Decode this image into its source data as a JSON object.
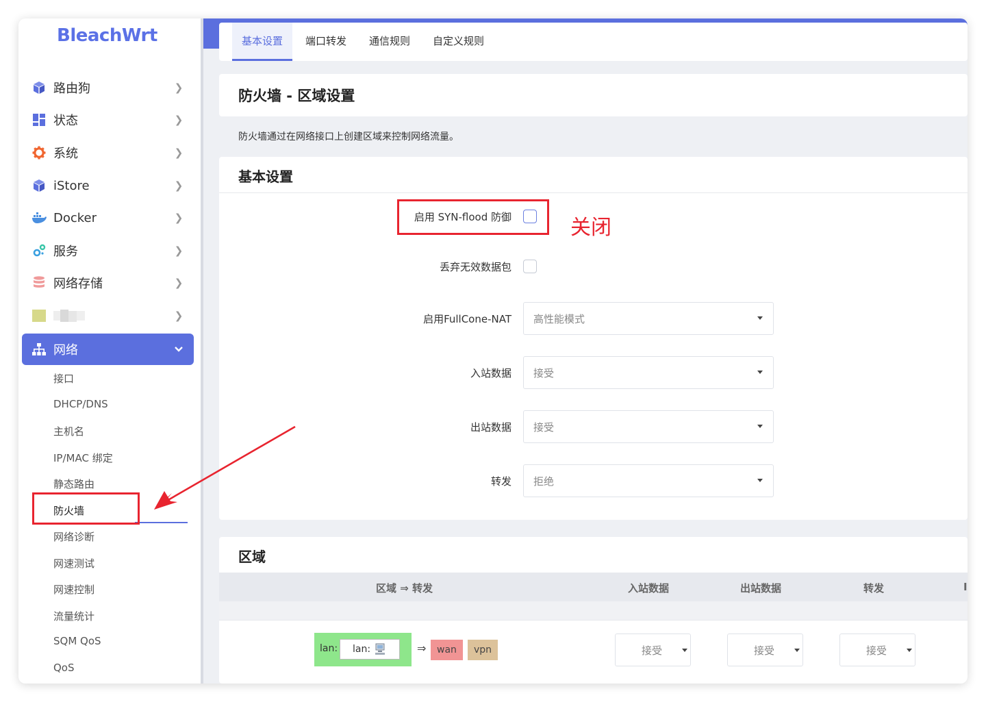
{
  "logo": "BleachWrt",
  "sidebar": {
    "items": [
      {
        "label": "路由狗",
        "icon": "cube-icon",
        "color": "#5b6fde"
      },
      {
        "label": "状态",
        "icon": "dashboard-icon",
        "color": "#5b6fde"
      },
      {
        "label": "系统",
        "icon": "gear-icon",
        "color": "#f0652f"
      },
      {
        "label": "iStore",
        "icon": "cube-icon",
        "color": "#5b6fde"
      },
      {
        "label": "Docker",
        "icon": "docker-icon",
        "color": "#4a8fe0"
      },
      {
        "label": "服务",
        "icon": "cogs-icon",
        "color": "#3aa0e0"
      },
      {
        "label": "网络存储",
        "icon": "database-icon",
        "color": "#f09a9a"
      },
      {
        "label": "",
        "icon": "blurred-icon",
        "color": "#d7d98a"
      },
      {
        "label": "网络",
        "icon": "sitemap-icon",
        "color": "#ffffff"
      }
    ],
    "sub_items": [
      "接口",
      "DHCP/DNS",
      "主机名",
      "IP/MAC 绑定",
      "静态路由",
      "防火墙",
      "网络诊断",
      "网速测试",
      "网速控制",
      "流量统计",
      "SQM QoS",
      "QoS"
    ]
  },
  "tabs": [
    "基本设置",
    "端口转发",
    "通信规则",
    "自定义规则"
  ],
  "page": {
    "title": "防火墙 - 区域设置",
    "description": "防火墙通过在网络接口上创建区域来控制网络流量。"
  },
  "basic": {
    "title": "基本设置",
    "syn_flood_label": "启用 SYN-flood 防御",
    "drop_invalid_label": "丢弃无效数据包",
    "fullcone_label": "启用FullCone-NAT",
    "fullcone_value": "高性能模式",
    "input_label": "入站数据",
    "input_value": "接受",
    "output_label": "出站数据",
    "output_value": "接受",
    "forward_label": "转发",
    "forward_value": "拒绝"
  },
  "zones": {
    "title": "区域",
    "headers": [
      "区域 ⇒ 转发",
      "入站数据",
      "出站数据",
      "转发",
      "I"
    ],
    "row": {
      "zone_label": "lan:",
      "zone_inner": "lan:",
      "arrow": "⇒",
      "targets": [
        "wan",
        "vpn"
      ],
      "input": "接受",
      "output": "接受",
      "forward": "接受"
    }
  },
  "annotation": "关闭",
  "colors": {
    "accent": "#5b6fde",
    "annotation": "#e8242f",
    "zone_lan": "#8ee68b",
    "zone_wan": "#f19494",
    "zone_vpn": "#dcc29a"
  }
}
